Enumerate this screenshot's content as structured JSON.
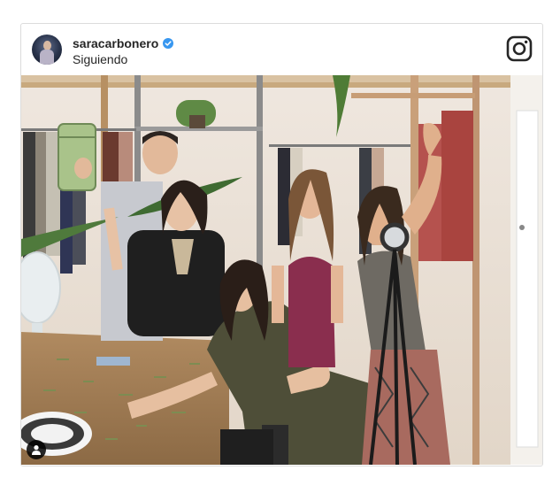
{
  "post": {
    "username": "saracarbonero",
    "verified": true,
    "follow_status": "Siguiendo"
  },
  "icons": {
    "brand": "instagram-icon",
    "verified": "verified-badge-icon",
    "tagged_users": "user-tag-icon"
  },
  "colors": {
    "verified_blue": "#3897f0",
    "card_border": "#dcdcdc",
    "text": "#262626"
  }
}
